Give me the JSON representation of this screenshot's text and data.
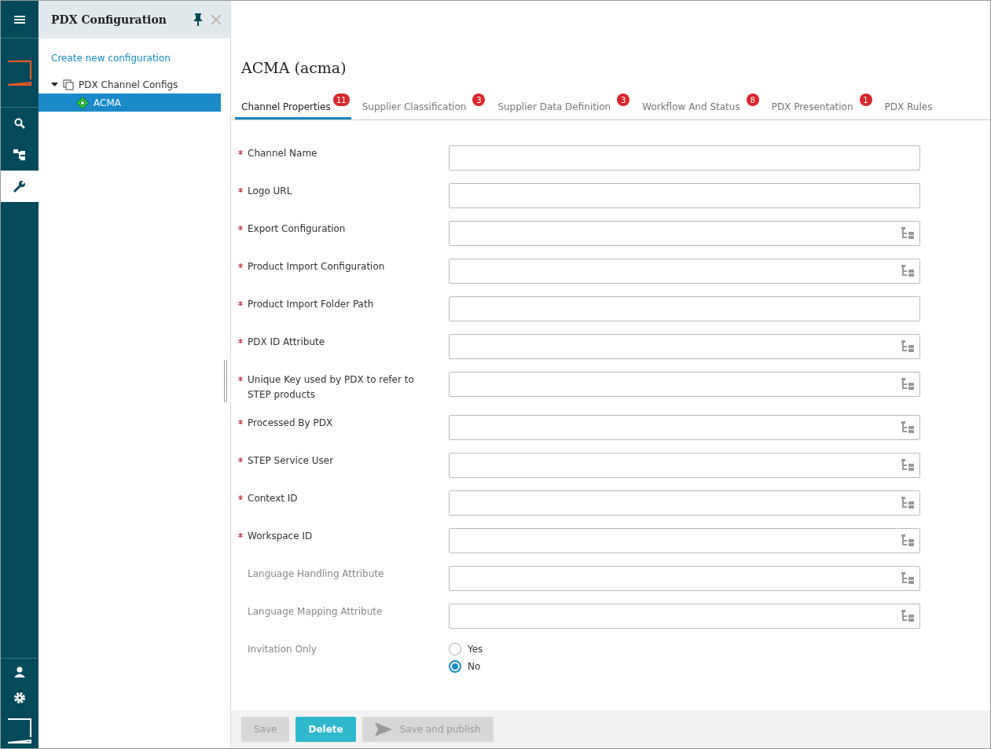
{
  "panel": {
    "title": "PDX Configuration",
    "create_link": "Create new configuration",
    "tree": [
      {
        "label": "PDX Channel Configs",
        "expanded": true,
        "selected": false,
        "children": [
          {
            "label": "ACMA",
            "selected": true
          }
        ]
      }
    ]
  },
  "rail": {
    "items": [
      {
        "kind": "search",
        "selected": false
      },
      {
        "kind": "tree",
        "selected": false
      },
      {
        "kind": "wrench",
        "selected": true
      }
    ]
  },
  "page": {
    "title": "ACMA (acma)"
  },
  "tabs": [
    {
      "label": "Channel Properties",
      "badge": "11",
      "selected": true
    },
    {
      "label": "Supplier Classification",
      "badge": "3",
      "selected": false
    },
    {
      "label": "Supplier Data Definition",
      "badge": "3",
      "selected": false
    },
    {
      "label": "Workflow And Status",
      "badge": "8",
      "selected": false
    },
    {
      "label": "PDX Presentation",
      "badge": "1",
      "selected": false
    },
    {
      "label": "PDX Rules",
      "selected": false
    }
  ],
  "fields": [
    {
      "label": "Channel Name",
      "required": true,
      "picker": false
    },
    {
      "label": "Logo URL",
      "required": true,
      "picker": false
    },
    {
      "label": "Export Configuration",
      "required": true,
      "picker": true
    },
    {
      "label": "Product Import Configuration",
      "required": true,
      "picker": true
    },
    {
      "label": "Product Import Folder Path",
      "required": true,
      "picker": false
    },
    {
      "label": "PDX ID Attribute",
      "required": true,
      "picker": true
    },
    {
      "label": "Unique Key used by PDX to refer to STEP products",
      "required": true,
      "picker": true
    },
    {
      "label": "Processed By PDX",
      "required": true,
      "picker": true
    },
    {
      "label": "STEP Service User",
      "required": true,
      "picker": true
    },
    {
      "label": "Context ID",
      "required": true,
      "picker": true
    },
    {
      "label": "Workspace ID",
      "required": true,
      "picker": true
    },
    {
      "label": "Language Handling Attribute",
      "required": false,
      "picker": true
    },
    {
      "label": "Language Mapping Attribute",
      "required": false,
      "picker": true
    }
  ],
  "invitation": {
    "label": "Invitation Only",
    "options": [
      {
        "label": "Yes",
        "selected": false
      },
      {
        "label": "No",
        "selected": true
      }
    ]
  },
  "buttons": [
    {
      "label": "Save",
      "kind": "plain",
      "disabled": true
    },
    {
      "label": "Delete",
      "kind": "primary",
      "disabled": false
    },
    {
      "label": "Save and publish",
      "kind": "publish",
      "disabled": true
    }
  ]
}
